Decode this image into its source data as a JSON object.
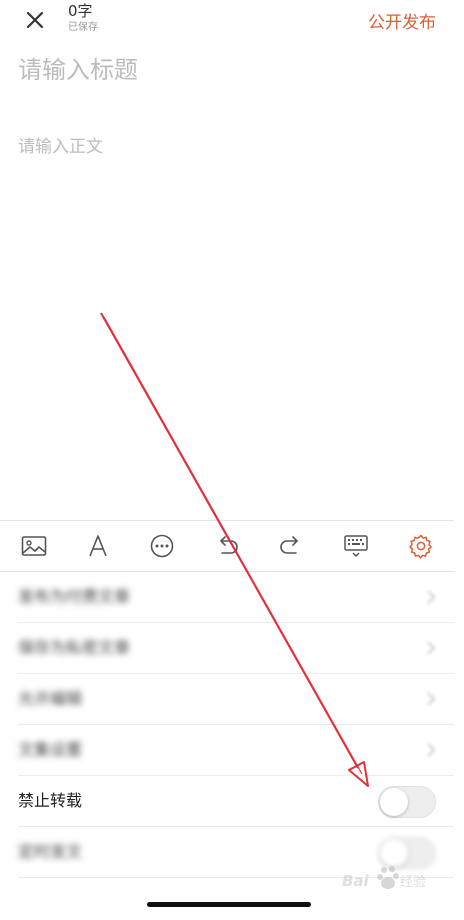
{
  "header": {
    "word_count": "0字",
    "saved_status": "已保存",
    "publish_label": "公开发布",
    "accent_color": "#d9603b"
  },
  "editor": {
    "title_placeholder": "请输入标题",
    "body_placeholder": "请输入正文"
  },
  "toolbar": {
    "tools": [
      "image-icon",
      "font-icon",
      "more-icon",
      "undo-icon",
      "redo-icon",
      "keyboard-icon",
      "settings-gear-icon"
    ]
  },
  "settings": {
    "rows": [
      {
        "label": "发布为付费文章",
        "control": "chevron",
        "blurred": true
      },
      {
        "label": "保存为私密文章",
        "control": "chevron",
        "blurred": true
      },
      {
        "label": "允许编辑",
        "control": "chevron",
        "blurred": true
      },
      {
        "label": "文集设置",
        "control": "chevron",
        "blurred": true
      },
      {
        "label": "禁止转载",
        "control": "toggle",
        "toggle_on": false,
        "blurred": false
      },
      {
        "label": "定时发文",
        "control": "toggle",
        "toggle_on": false,
        "blurred": true
      }
    ]
  },
  "watermark": {
    "logo": "Baidu 经验"
  }
}
